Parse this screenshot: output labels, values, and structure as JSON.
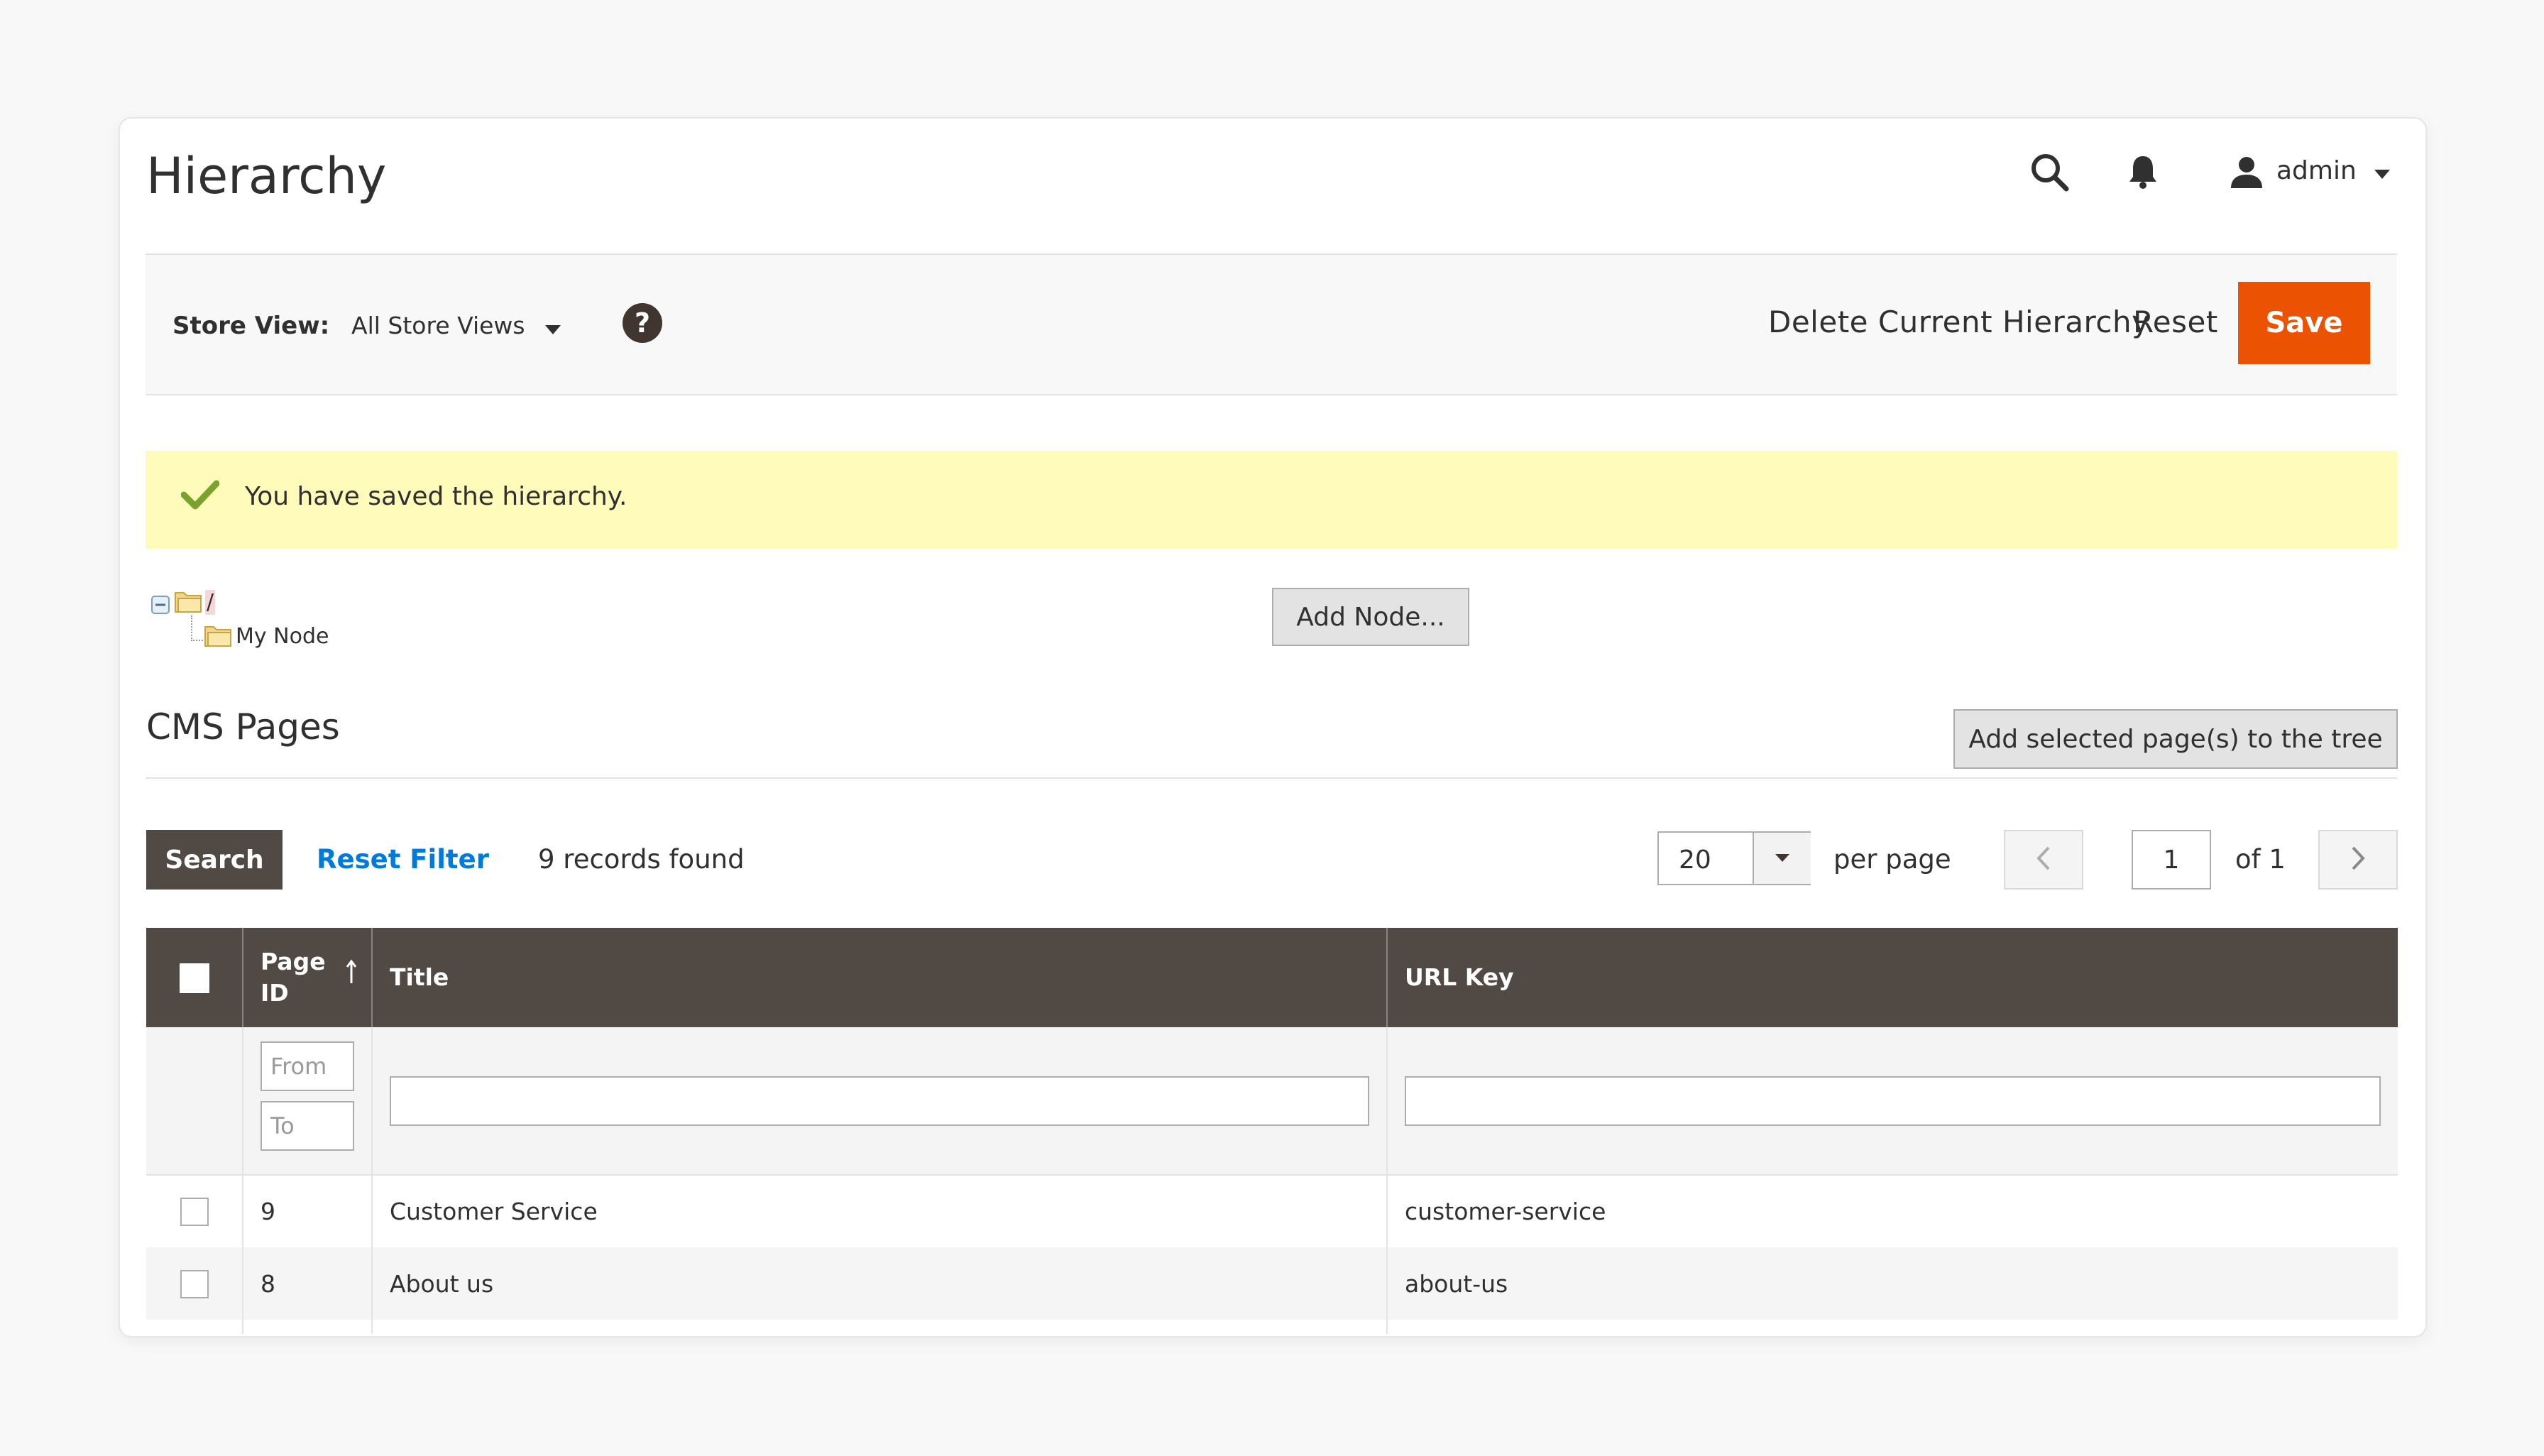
{
  "page": {
    "title": "Hierarchy",
    "user": {
      "name": "admin"
    }
  },
  "toolbar": {
    "store_view_label": "Store View:",
    "store_view_value": "All Store Views",
    "delete_label": "Delete Current Hierarchy",
    "reset_label": "Reset",
    "save_label": "Save"
  },
  "message": {
    "text": "You have saved the hierarchy."
  },
  "tree": {
    "root_label": "/",
    "nodes": [
      {
        "label": "My Node"
      }
    ],
    "add_node_label": "Add Node..."
  },
  "cms": {
    "title": "CMS Pages",
    "add_selected_label": "Add selected page(s) to the tree",
    "search_label": "Search",
    "reset_filter_label": "Reset Filter",
    "records_found": "9 records found",
    "per_page_value": "20",
    "per_page_label": "per page",
    "page_number": "1",
    "of_pages": "of 1",
    "columns": {
      "page_id": "Page ID",
      "title": "Title",
      "url_key": "URL Key"
    },
    "filters": {
      "from_placeholder": "From",
      "to_placeholder": "To"
    },
    "rows": [
      {
        "id": "9",
        "title": "Customer Service",
        "url_key": "customer-service"
      },
      {
        "id": "8",
        "title": "About us",
        "url_key": "about-us"
      }
    ]
  },
  "colors": {
    "accent": "#eb5202",
    "header_dark": "#514943",
    "link": "#007bdb",
    "success_bg": "#fffbbb",
    "success_icon": "#79a22e"
  },
  "icons": [
    "search-icon",
    "bell-icon",
    "user-icon",
    "caret-down-icon",
    "help-icon",
    "check-icon",
    "folder-icon",
    "chevron-left-icon",
    "chevron-right-icon",
    "sort-arrow-icon"
  ]
}
